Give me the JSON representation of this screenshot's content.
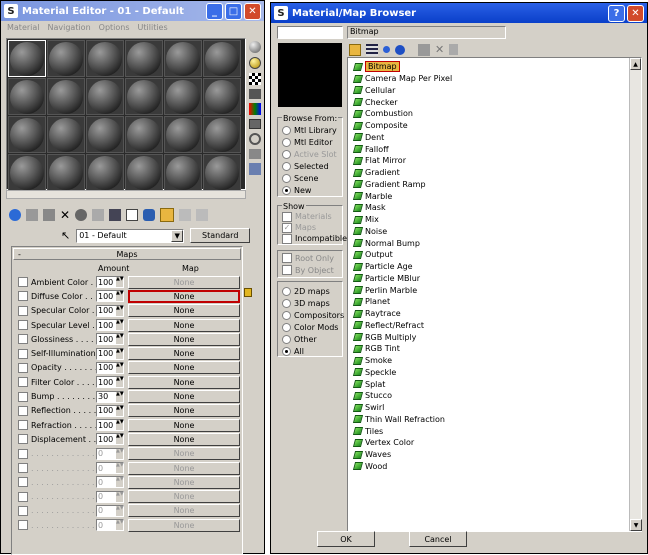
{
  "editor": {
    "title": "Material Editor - 01 - Default",
    "menu": [
      "Material",
      "Navigation",
      "Options",
      "Utilities"
    ],
    "material_name": "01 - Default",
    "type_button": "Standard",
    "rollout_title": "Maps",
    "col_amount": "Amount",
    "col_map": "Map",
    "maps": [
      {
        "label": "Ambient Color . . . .",
        "amount": "100",
        "map": "None",
        "enabled": true,
        "dim": true
      },
      {
        "label": "Diffuse Color . . . .",
        "amount": "100",
        "map": "None",
        "enabled": true,
        "highlight": true
      },
      {
        "label": "Specular Color . .",
        "amount": "100",
        "map": "None",
        "enabled": true
      },
      {
        "label": "Specular Level .",
        "amount": "100",
        "map": "None",
        "enabled": true
      },
      {
        "label": "Glossiness . . . . . .",
        "amount": "100",
        "map": "None",
        "enabled": true
      },
      {
        "label": "Self-Illumination .",
        "amount": "100",
        "map": "None",
        "enabled": true
      },
      {
        "label": "Opacity . . . . . . . . .",
        "amount": "100",
        "map": "None",
        "enabled": true
      },
      {
        "label": "Filter Color . . . . .",
        "amount": "100",
        "map": "None",
        "enabled": true
      },
      {
        "label": "Bump . . . . . . . . . .",
        "amount": "30",
        "map": "None",
        "enabled": true
      },
      {
        "label": "Reflection . . . . . .",
        "amount": "100",
        "map": "None",
        "enabled": true
      },
      {
        "label": "Refraction . . . . . .",
        "amount": "100",
        "map": "None",
        "enabled": true
      },
      {
        "label": "Displacement . . .",
        "amount": "100",
        "map": "None",
        "enabled": true
      },
      {
        "label": ". . . . . . . . . . . . . .",
        "amount": "0",
        "map": "None",
        "enabled": false
      },
      {
        "label": ". . . . . . . . . . . . . .",
        "amount": "0",
        "map": "None",
        "enabled": false
      },
      {
        "label": ". . . . . . . . . . . . . .",
        "amount": "0",
        "map": "None",
        "enabled": false
      },
      {
        "label": ". . . . . . . . . . . . . .",
        "amount": "0",
        "map": "None",
        "enabled": false
      },
      {
        "label": ". . . . . . . . . . . . . .",
        "amount": "0",
        "map": "None",
        "enabled": false
      },
      {
        "label": ". . . . . . . . . . . . . .",
        "amount": "0",
        "map": "None",
        "enabled": false
      }
    ]
  },
  "browser": {
    "title": "Material/Map Browser",
    "name_field": "",
    "selected_name": "Bitmap",
    "browse_from": {
      "title": "Browse From:",
      "options": [
        "Mtl Library",
        "Mtl Editor",
        "Active Slot",
        "Selected",
        "Scene",
        "New"
      ],
      "selected": "New",
      "disabled": [
        "Active Slot"
      ]
    },
    "show": {
      "title": "Show",
      "options": [
        "Materials",
        "Maps",
        "Incompatible"
      ],
      "checked": [
        "Maps"
      ],
      "disabled": [
        "Materials",
        "Maps"
      ]
    },
    "root_only": "Root Only",
    "by_object": "By Object",
    "filter": {
      "options": [
        "2D maps",
        "3D maps",
        "Compositors",
        "Color Mods",
        "Other",
        "All"
      ],
      "selected": "All"
    },
    "items": [
      "Bitmap",
      "Camera Map Per Pixel",
      "Cellular",
      "Checker",
      "Combustion",
      "Composite",
      "Dent",
      "Falloff",
      "Flat Mirror",
      "Gradient",
      "Gradient Ramp",
      "Marble",
      "Mask",
      "Mix",
      "Noise",
      "Normal Bump",
      "Output",
      "Particle Age",
      "Particle MBlur",
      "Perlin Marble",
      "Planet",
      "Raytrace",
      "Reflect/Refract",
      "RGB Multiply",
      "RGB Tint",
      "Smoke",
      "Speckle",
      "Splat",
      "Stucco",
      "Swirl",
      "Thin Wall Refraction",
      "Tiles",
      "Vertex Color",
      "Waves",
      "Wood"
    ],
    "selected_item": "Bitmap",
    "ok": "OK",
    "cancel": "Cancel"
  }
}
